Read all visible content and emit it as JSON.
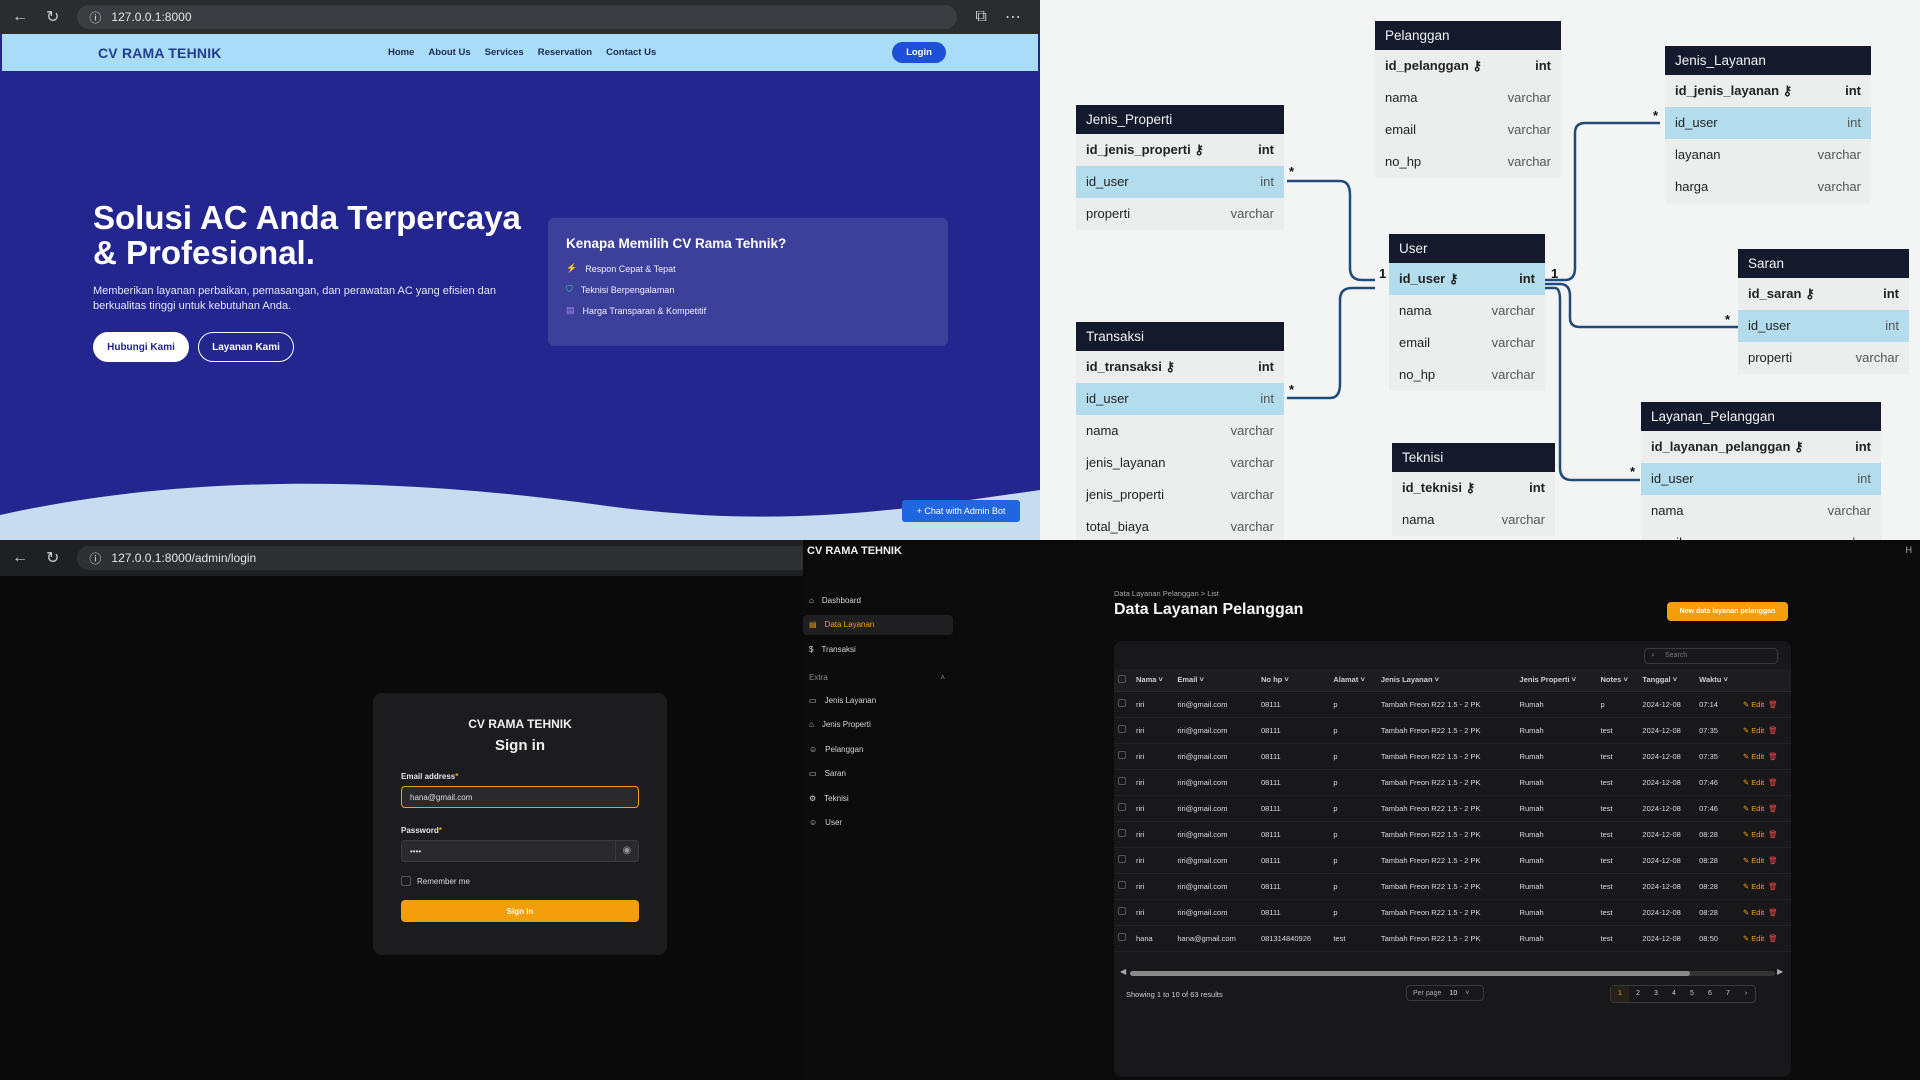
{
  "landing": {
    "url": "127.0.0.1:8000",
    "brand": "CV RAMA TEHNIK",
    "menu": [
      "Home",
      "About Us",
      "Services",
      "Reservation",
      "Contact Us"
    ],
    "login": "Login",
    "hero_title": "Solusi AC Anda Terpercaya & Profesional.",
    "hero_sub": "Memberikan layanan perbaikan, pemasangan, dan perawatan AC yang efisien dan berkualitas tinggi untuk kebutuhan Anda.",
    "btn_contact": "Hubungi Kami",
    "btn_services": "Layanan Kami",
    "why_title": "Kenapa Memilih CV Rama Tehnik?",
    "why_items": [
      "Respon Cepat & Tepat",
      "Teknisi Berpengalaman",
      "Harga Transparan & Kompetitif"
    ],
    "chat": "Chat with Admin Bot"
  },
  "erd": {
    "tables": {
      "jenis_properti": {
        "name": "Jenis_Properti",
        "cols": [
          [
            "id_jenis_properti",
            "int"
          ],
          [
            "id_user",
            "int"
          ],
          [
            "properti",
            "varchar"
          ]
        ]
      },
      "pelanggan": {
        "name": "Pelanggan",
        "cols": [
          [
            "id_pelanggan",
            "int"
          ],
          [
            "nama",
            "varchar"
          ],
          [
            "email",
            "varchar"
          ],
          [
            "no_hp",
            "varchar"
          ]
        ]
      },
      "jenis_layanan": {
        "name": "Jenis_Layanan",
        "cols": [
          [
            "id_jenis_layanan",
            "int"
          ],
          [
            "id_user",
            "int"
          ],
          [
            "layanan",
            "varchar"
          ],
          [
            "harga",
            "varchar"
          ]
        ]
      },
      "user": {
        "name": "User",
        "cols": [
          [
            "id_user",
            "int"
          ],
          [
            "nama",
            "varchar"
          ],
          [
            "email",
            "varchar"
          ],
          [
            "no_hp",
            "varchar"
          ]
        ]
      },
      "saran": {
        "name": "Saran",
        "cols": [
          [
            "id_saran",
            "int"
          ],
          [
            "id_user",
            "int"
          ],
          [
            "properti",
            "varchar"
          ]
        ]
      },
      "transaksi": {
        "name": "Transaksi",
        "cols": [
          [
            "id_transaksi",
            "int"
          ],
          [
            "id_user",
            "int"
          ],
          [
            "nama",
            "varchar"
          ],
          [
            "jenis_layanan",
            "varchar"
          ],
          [
            "jenis_properti",
            "varchar"
          ],
          [
            "total_biaya",
            "varchar"
          ]
        ]
      },
      "teknisi": {
        "name": "Teknisi",
        "cols": [
          [
            "id_teknisi",
            "int"
          ],
          [
            "nama",
            "varchar"
          ]
        ]
      },
      "layanan_pelanggan": {
        "name": "Layanan_Pelanggan",
        "cols": [
          [
            "id_layanan_pelanggan",
            "int"
          ],
          [
            "id_user",
            "int"
          ],
          [
            "nama",
            "varchar"
          ],
          [
            "email",
            "varchar"
          ]
        ]
      }
    },
    "one": "1",
    "many": "*"
  },
  "admin_login": {
    "url": "127.0.0.1:8000/admin/login",
    "brand": "CV RAMA TEHNIK",
    "title": "Sign in",
    "email_label": "Email address",
    "email_value": "hana@gmail.com",
    "password_label": "Password",
    "password_value": "••••",
    "remember": "Remember me",
    "signin": "Sign in"
  },
  "admin": {
    "brand": "CV RAMA TEHNIK",
    "nav": [
      "Dashboard",
      "Data Layanan",
      "Transaksi"
    ],
    "group": "Extra",
    "extra_nav": [
      "Jenis Layanan",
      "Jenis Properti",
      "Pelanggan",
      "Saran",
      "Teknisi",
      "User"
    ],
    "crumb": "Data Layanan Pelanggan  >  List",
    "title": "Data Layanan Pelanggan",
    "new_button": "New data layanan pelanggan",
    "search_placeholder": "Search",
    "columns": [
      "Nama",
      "Email",
      "No hp",
      "Alamat",
      "Jenis Layanan",
      "Jenis Properti",
      "Notes",
      "Tanggal",
      "Waktu"
    ],
    "rows": [
      [
        "riri",
        "riri@gmail.com",
        "08111",
        "p",
        "Tambah Freon R22 1.5 - 2 PK",
        "Rumah",
        "p",
        "2024-12-08",
        "07:14"
      ],
      [
        "riri",
        "riri@gmail.com",
        "08111",
        "p",
        "Tambah Freon R22 1.5 - 2 PK",
        "Rumah",
        "test",
        "2024-12-08",
        "07:35"
      ],
      [
        "riri",
        "riri@gmail.com",
        "08111",
        "p",
        "Tambah Freon R22 1.5 - 2 PK",
        "Rumah",
        "test",
        "2024-12-08",
        "07:35"
      ],
      [
        "riri",
        "riri@gmail.com",
        "08111",
        "p",
        "Tambah Freon R22 1.5 - 2 PK",
        "Rumah",
        "test",
        "2024-12-08",
        "07:46"
      ],
      [
        "riri",
        "riri@gmail.com",
        "08111",
        "p",
        "Tambah Freon R22 1.5 - 2 PK",
        "Rumah",
        "test",
        "2024-12-08",
        "07:46"
      ],
      [
        "riri",
        "riri@gmail.com",
        "08111",
        "p",
        "Tambah Freon R22 1.5 - 2 PK",
        "Rumah",
        "test",
        "2024-12-08",
        "08:28"
      ],
      [
        "riri",
        "riri@gmail.com",
        "08111",
        "p",
        "Tambah Freon R22 1.5 - 2 PK",
        "Rumah",
        "test",
        "2024-12-08",
        "08:28"
      ],
      [
        "riri",
        "riri@gmail.com",
        "08111",
        "p",
        "Tambah Freon R22 1.5 - 2 PK",
        "Rumah",
        "test",
        "2024-12-08",
        "08:28"
      ],
      [
        "riri",
        "riri@gmail.com",
        "08111",
        "p",
        "Tambah Freon R22 1.5 - 2 PK",
        "Rumah",
        "test",
        "2024-12-08",
        "08:28"
      ],
      [
        "hana",
        "hana@gmail.com",
        "081314840926",
        "test",
        "Tambah Freon R22 1.5 - 2 PK",
        "Rumah",
        "test",
        "2024-12-08",
        "08:50"
      ]
    ],
    "edit": "Edit",
    "footer": "Showing 1 to 10 of 63 results",
    "per_page_label": "Per page",
    "per_page_value": "10",
    "pages": [
      "1",
      "2",
      "3",
      "4",
      "5",
      "6",
      "7"
    ],
    "accent": "#f59e0b"
  }
}
